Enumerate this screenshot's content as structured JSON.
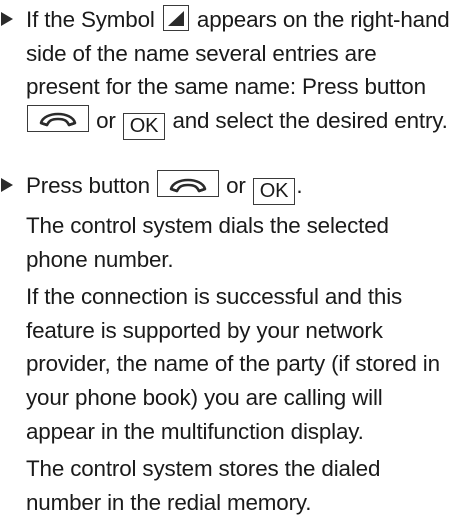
{
  "step1": {
    "line1_before": "If the Symbol",
    "line1_after": "appears on the right-hand",
    "line2": "side of the name several entries are",
    "line3": "present for the same name: Press button",
    "line4_or": "or",
    "line4_after": "and select the desired entry.",
    "ok_key": "OK"
  },
  "step2": {
    "line1_before": "Press button",
    "line1_or": "or",
    "line1_end": ".",
    "ok_key": "OK",
    "para1_line1": "The control system dials the selected",
    "para1_line2": "phone number.",
    "para2_line1": "If the connection is successful and this",
    "para2_line2": "feature is supported by your network",
    "para2_line3": "provider, the name of the party (if stored in",
    "para2_line4": "your phone book) you are calling will",
    "para2_line5": "appear in the multifunction display.",
    "para3_line1": "The control system stores the dialed",
    "para3_line2": "number in the redial memory."
  },
  "icons": {
    "bullet": "triangle-bullet-icon",
    "phone_key": "phone-handset-icon",
    "entries_symbol": "corner-triangle-symbol-icon"
  },
  "colors": {
    "text": "#1a1a1a",
    "key_border": "#3a3a3a"
  }
}
